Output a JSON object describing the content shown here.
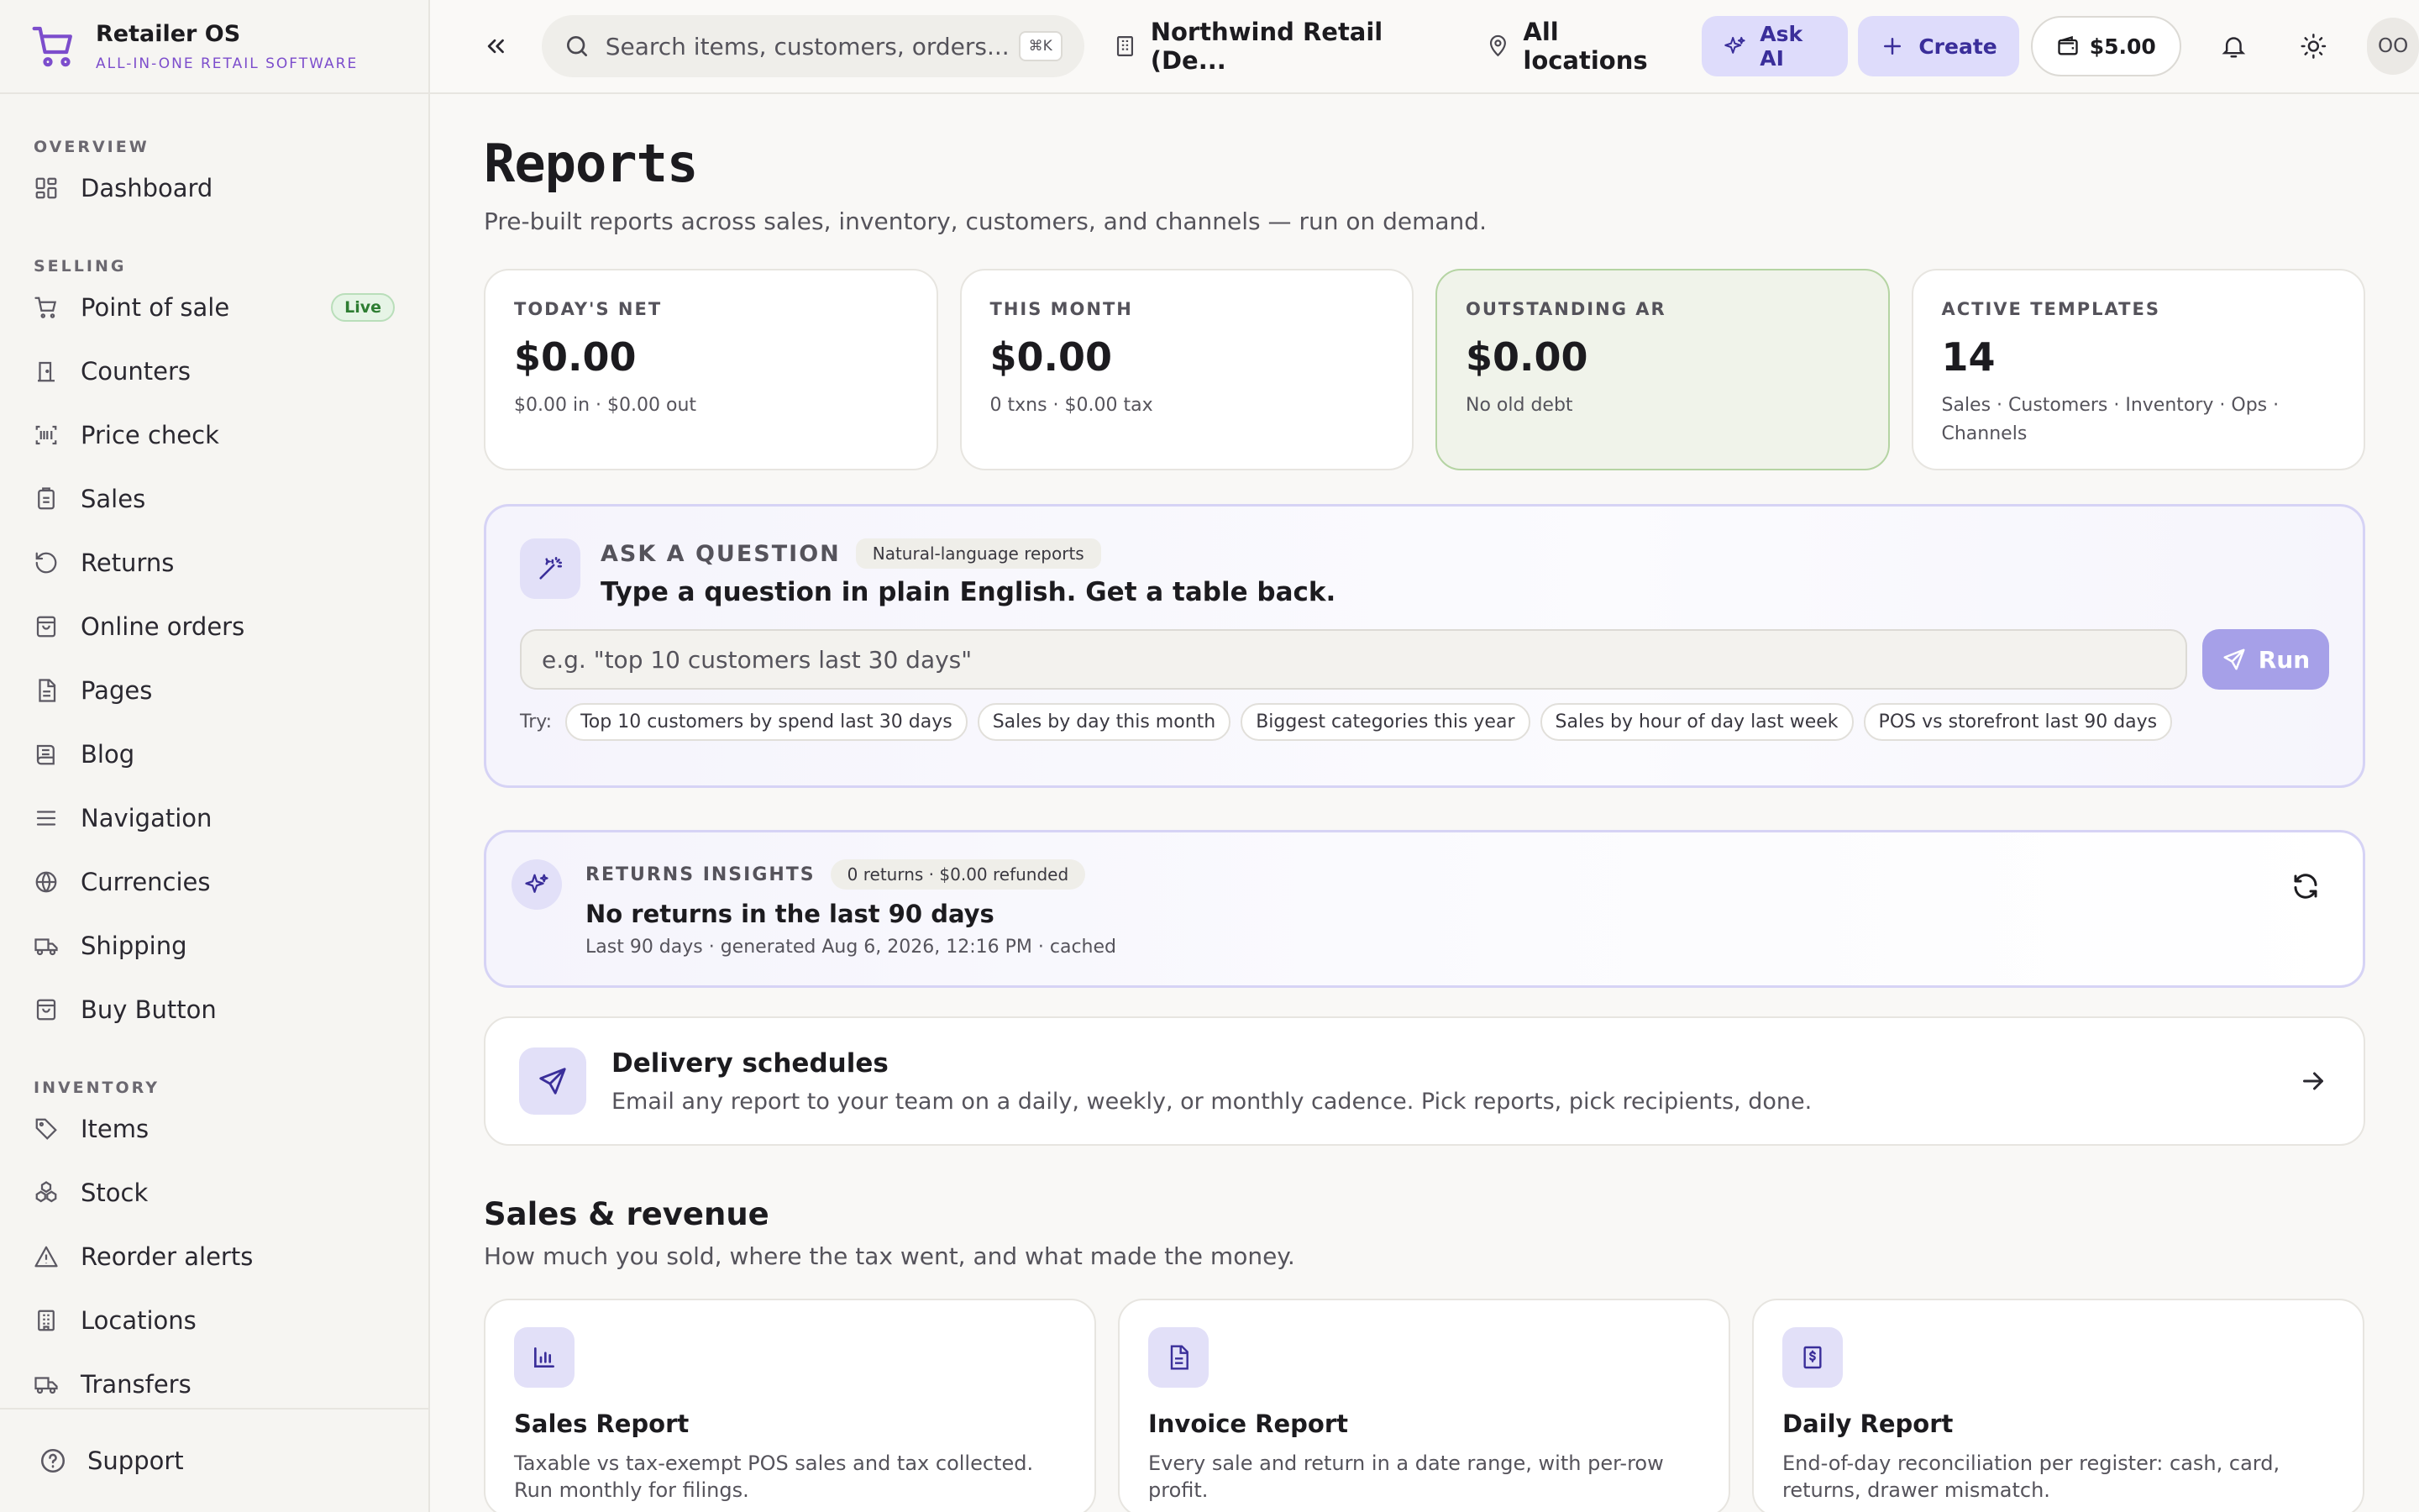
{
  "brand": {
    "name": "Retailer OS",
    "tagline": "ALL-IN-ONE RETAIL SOFTWARE",
    "accent": "#7c4dcc"
  },
  "sidebar": {
    "groups": [
      {
        "heading": "OVERVIEW",
        "items": [
          {
            "label": "Dashboard",
            "icon": "dashboard-icon"
          }
        ]
      },
      {
        "heading": "SELLING",
        "items": [
          {
            "label": "Point of sale",
            "icon": "cart-icon",
            "badge": "Live"
          },
          {
            "label": "Counters",
            "icon": "door-icon"
          },
          {
            "label": "Price check",
            "icon": "barcode-icon"
          },
          {
            "label": "Sales",
            "icon": "clipboard-icon"
          },
          {
            "label": "Returns",
            "icon": "undo-icon"
          },
          {
            "label": "Online orders",
            "icon": "bag-icon"
          },
          {
            "label": "Pages",
            "icon": "file-icon"
          },
          {
            "label": "Blog",
            "icon": "book-icon"
          },
          {
            "label": "Navigation",
            "icon": "menu-icon"
          },
          {
            "label": "Currencies",
            "icon": "globe-icon"
          },
          {
            "label": "Shipping",
            "icon": "truck-icon"
          },
          {
            "label": "Buy Button",
            "icon": "bag-icon"
          }
        ]
      },
      {
        "heading": "INVENTORY",
        "items": [
          {
            "label": "Items",
            "icon": "tag-icon"
          },
          {
            "label": "Stock",
            "icon": "boxes-icon"
          },
          {
            "label": "Reorder alerts",
            "icon": "alert-icon"
          },
          {
            "label": "Locations",
            "icon": "building-icon"
          },
          {
            "label": "Transfers",
            "icon": "truck-icon"
          }
        ]
      }
    ],
    "footer": {
      "label": "Support",
      "icon": "help-icon"
    }
  },
  "topbar": {
    "search_placeholder": "Search items, customers, orders...",
    "shortcut": "⌘K",
    "org": "Northwind Retail (De...",
    "location": "All locations",
    "ask_ai": "Ask AI",
    "create": "Create",
    "balance": "$5.00",
    "avatar": "OO"
  },
  "page": {
    "title": "Reports",
    "subtitle": "Pre-built reports across sales, inventory, customers, and channels — run on demand."
  },
  "kpis": [
    {
      "label": "TODAY'S NET",
      "value": "$0.00",
      "sub": "$0.00 in · $0.00 out",
      "highlight": false
    },
    {
      "label": "THIS MONTH",
      "value": "$0.00",
      "sub": "0 txns · $0.00 tax",
      "highlight": false
    },
    {
      "label": "OUTSTANDING AR",
      "value": "$0.00",
      "sub": "No old debt",
      "highlight": true
    },
    {
      "label": "ACTIVE TEMPLATES",
      "value": "14",
      "sub": "Sales · Customers · Inventory · Ops · Channels",
      "highlight": false
    }
  ],
  "ask": {
    "kicker": "ASK A QUESTION",
    "chip": "Natural-language reports",
    "title": "Type a question in plain English. Get a table back.",
    "placeholder": "e.g. \"top 10 customers last 30 days\"",
    "run": "Run",
    "try_label": "Try:",
    "suggestions": [
      "Top 10 customers by spend last 30 days",
      "Sales by day this month",
      "Biggest categories this year",
      "Sales by hour of day last week",
      "POS vs storefront last 90 days"
    ]
  },
  "insights": {
    "kicker": "RETURNS INSIGHTS",
    "chip": "0 returns · $0.00 refunded",
    "title": "No returns in the last 90 days",
    "meta": "Last 90 days · generated Aug 6, 2026, 12:16 PM · cached"
  },
  "delivery": {
    "title": "Delivery schedules",
    "desc": "Email any report to your team on a daily, weekly, or monthly cadence. Pick reports, pick recipients, done."
  },
  "section": {
    "title": "Sales & revenue",
    "subtitle": "How much you sold, where the tax went, and what made the money.",
    "reports": [
      {
        "title": "Sales Report",
        "desc": "Taxable vs tax-exempt POS sales and tax collected. Run monthly for filings.",
        "icon": "bar-chart-icon"
      },
      {
        "title": "Invoice Report",
        "desc": "Every sale and return in a date range, with per-row profit.",
        "icon": "document-icon"
      },
      {
        "title": "Daily Report",
        "desc": "End-of-day reconciliation per register: cash, card, returns, drawer mismatch.",
        "icon": "receipt-dollar-icon"
      }
    ]
  }
}
